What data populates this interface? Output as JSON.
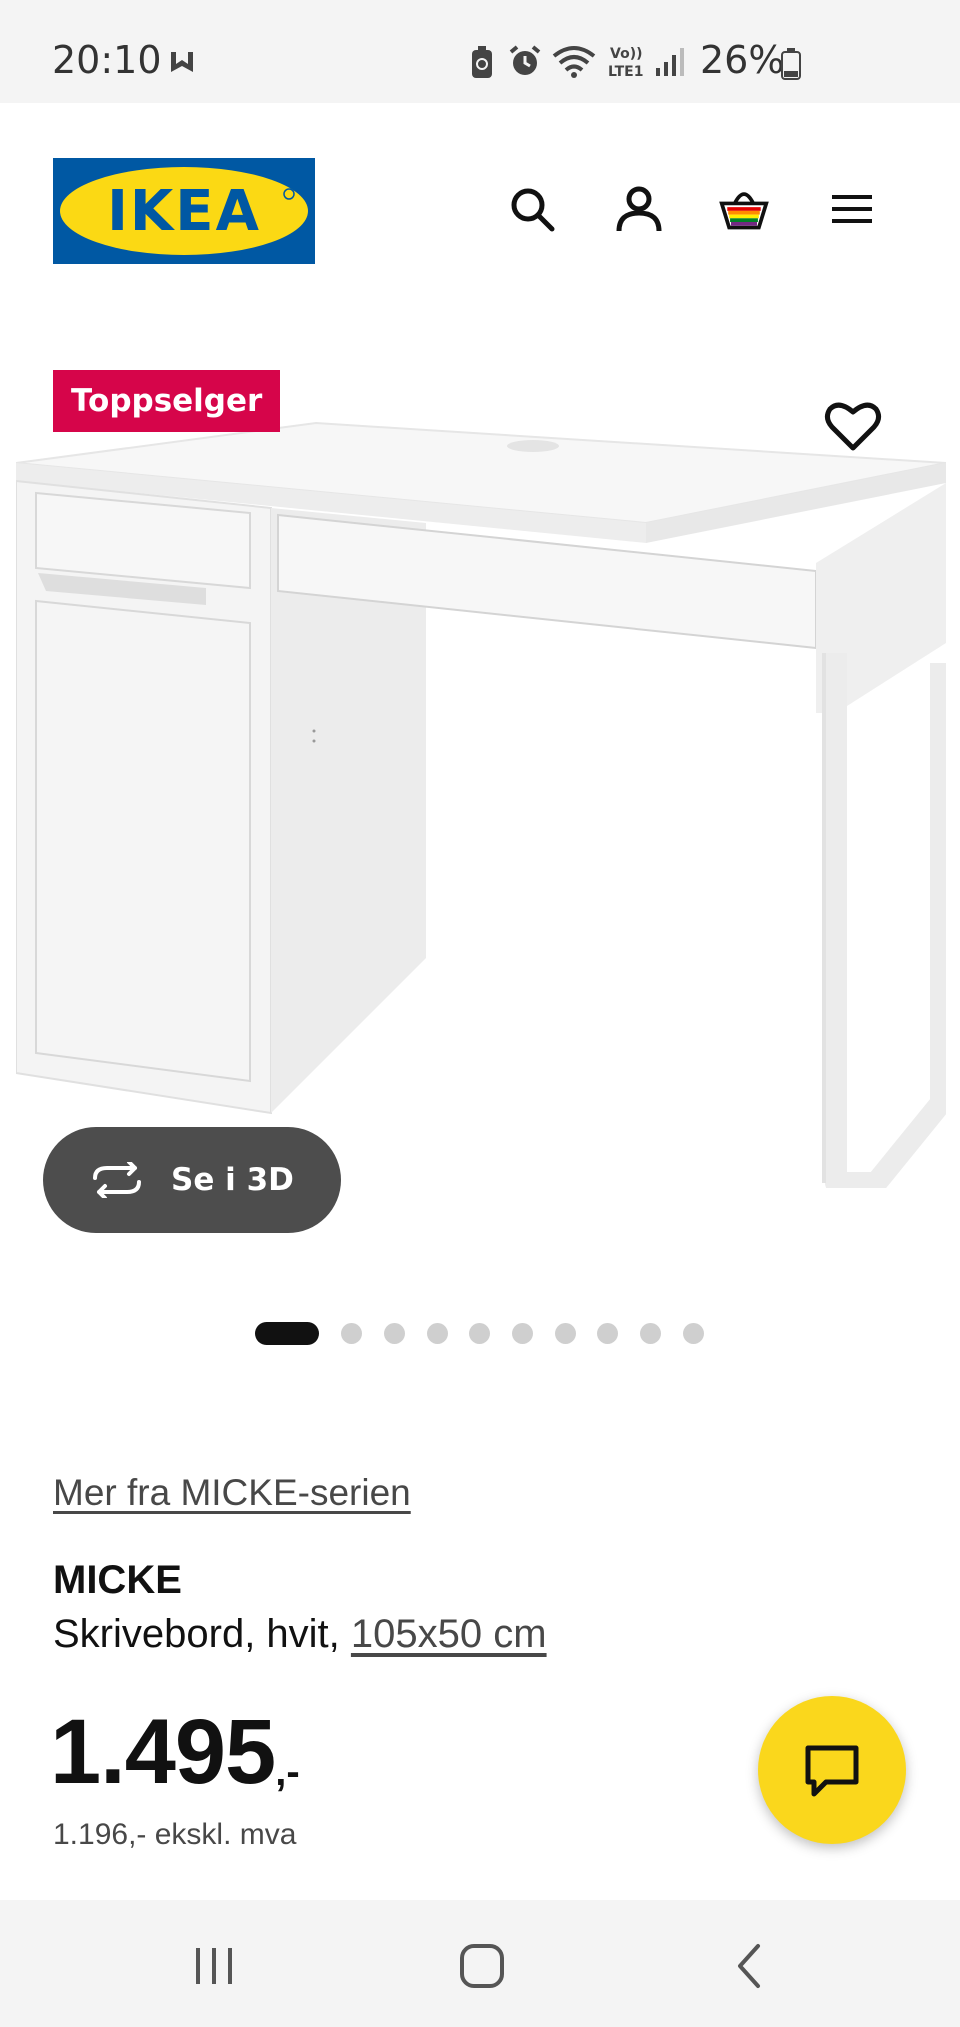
{
  "status_bar": {
    "time": "20:10",
    "battery": "26%",
    "icons": [
      "m-icon",
      "battery-saver-icon",
      "alarm-icon",
      "wifi-icon",
      "volte-lte-icon",
      "signal-icon",
      "battery-icon"
    ]
  },
  "header": {
    "logo_text": "IKEA",
    "icons": [
      "search-icon",
      "user-icon",
      "basket-icon",
      "menu-icon"
    ]
  },
  "product": {
    "badge": "Toppselger",
    "view_3d": "Se i 3D",
    "gallery": {
      "image_count": 10,
      "active_index": 0
    },
    "series_link": "Mer fra MICKE-serien",
    "name": "MICKE",
    "description": "Skrivebord, hvit,",
    "size_link": "105x50 cm",
    "price_main": "1.495",
    "price_suffix": ",-",
    "price_ex_vat": "1.196,- ekskl. mva"
  },
  "colors": {
    "brand_blue": "#0058a3",
    "brand_yellow": "#fbd914",
    "badge_red": "#d6054a",
    "chat_yellow": "#fad71c",
    "button_dark": "#4d4d4d"
  }
}
